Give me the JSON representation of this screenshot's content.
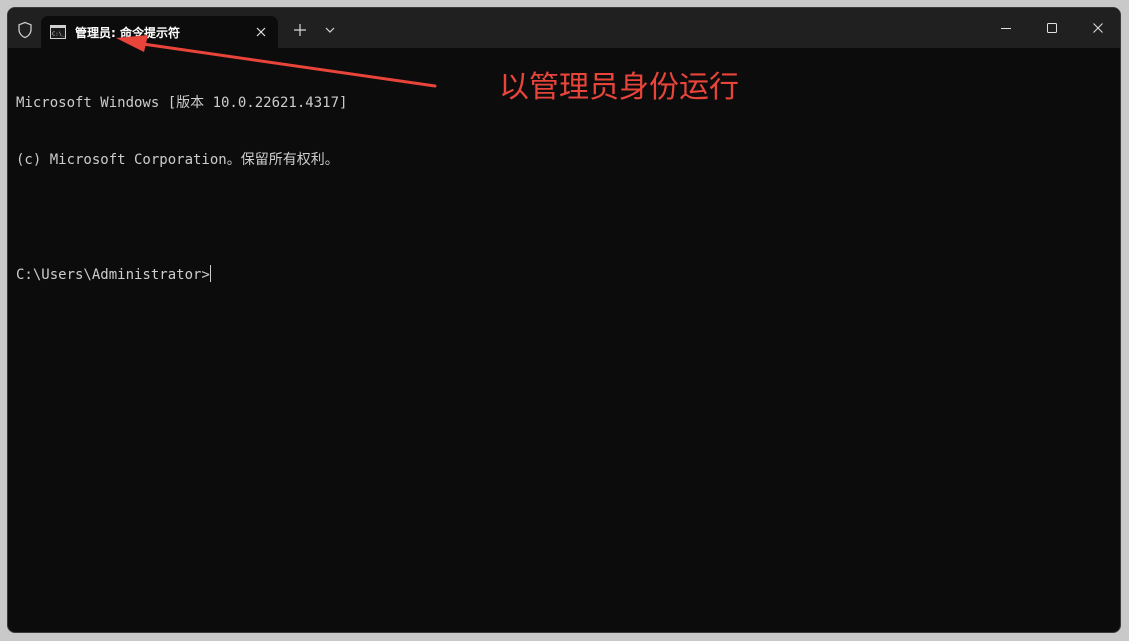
{
  "titlebar": {
    "tab_title": "管理员: 命令提示符",
    "icons": {
      "admin": "shield-icon",
      "tab": "console-icon",
      "close_tab": "close-icon",
      "new_tab": "plus-icon",
      "dropdown": "chevron-down-icon",
      "minimize": "minimize-icon",
      "maximize": "maximize-icon",
      "close_window": "close-icon"
    }
  },
  "console": {
    "lines": [
      "Microsoft Windows [版本 10.0.22621.4317]",
      "(c) Microsoft Corporation。保留所有权利。",
      "",
      "C:\\Users\\Administrator>"
    ]
  },
  "annotation": {
    "text": "以管理员身份运行",
    "color": "#e8443a"
  },
  "colors": {
    "background": "#0c0c0c",
    "titlebar": "#202020",
    "text": "#cccccc"
  }
}
